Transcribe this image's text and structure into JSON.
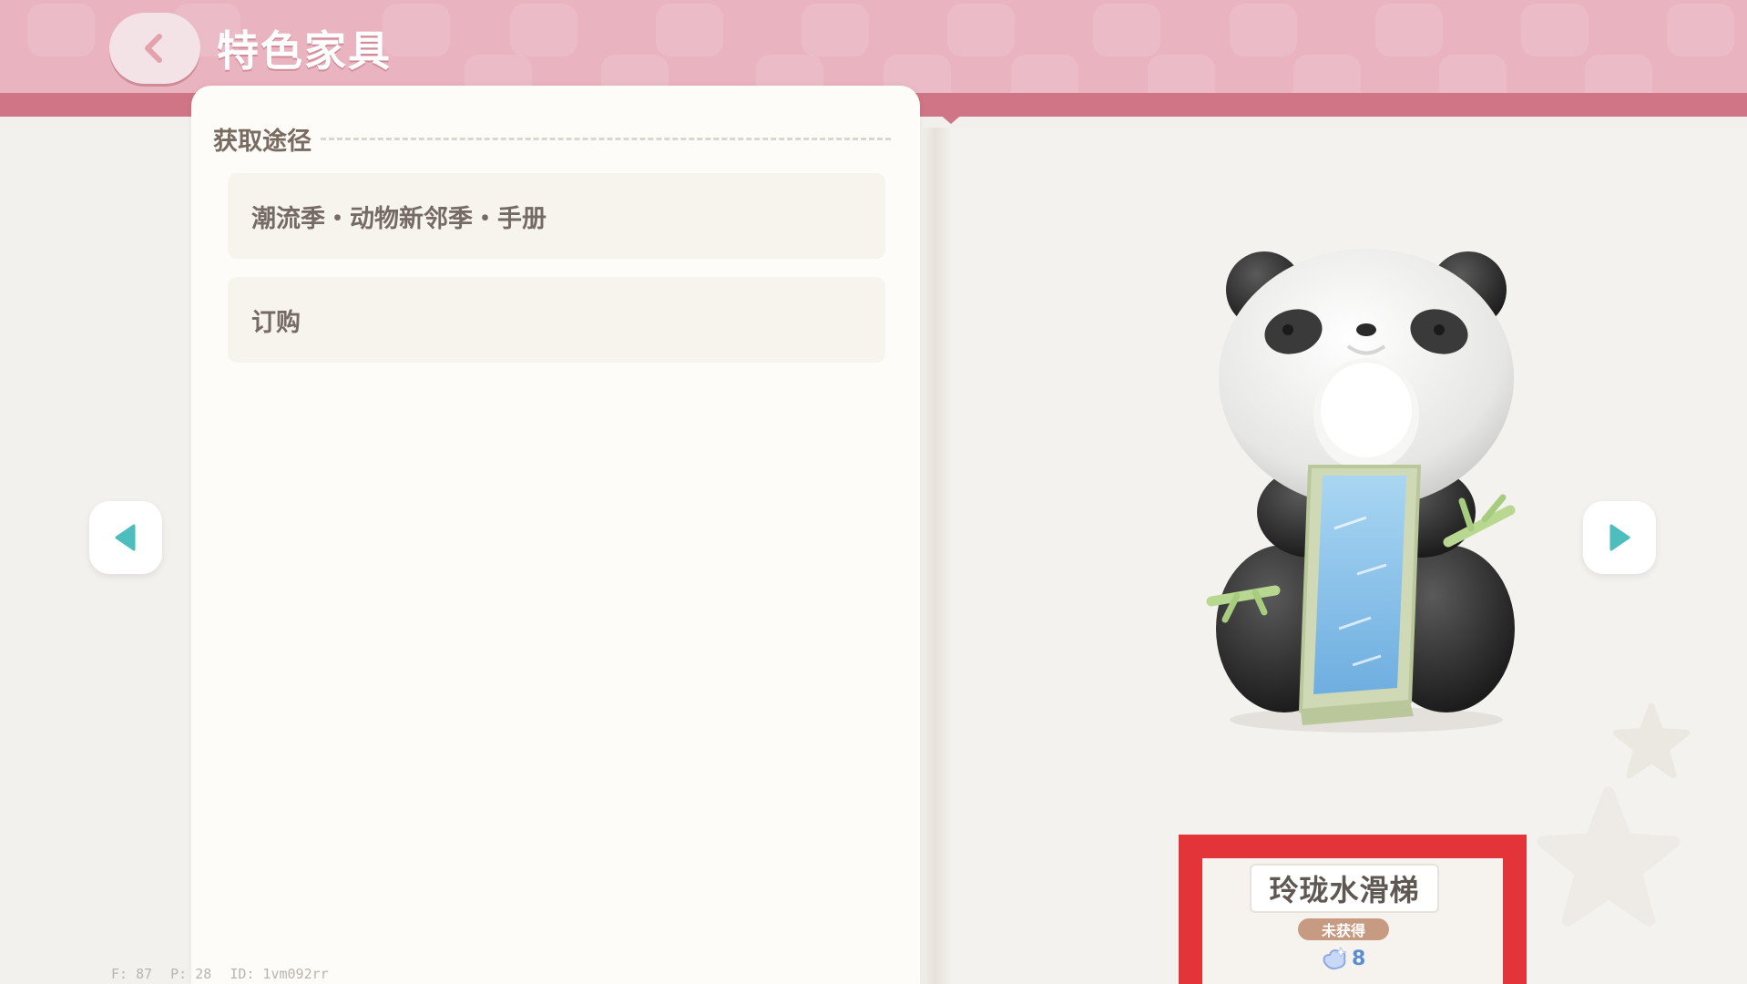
{
  "header": {
    "title": "特色家具",
    "back_icon": "chevron-left-icon",
    "color": "#e9b3bf",
    "stripe_color": "#cf7585"
  },
  "source": {
    "section_title": "获取途径",
    "items": [
      {
        "label": "潮流季・动物新邻季・手册"
      },
      {
        "label": "订购"
      }
    ]
  },
  "nav": {
    "prev_icon": "triangle-left-icon",
    "next_icon": "triangle-right-icon",
    "icon_color": "#4dbdbd"
  },
  "item": {
    "name": "玲珑水滑梯",
    "status": "未获得",
    "points": "8",
    "points_icon": "comfort-points-icon",
    "preview_icon": "panda-water-slide-image",
    "highlight_color": "#e3343a"
  },
  "debug": {
    "fps": "F: 87",
    "ping": "P: 28",
    "id": "ID: 1vm092rr"
  }
}
